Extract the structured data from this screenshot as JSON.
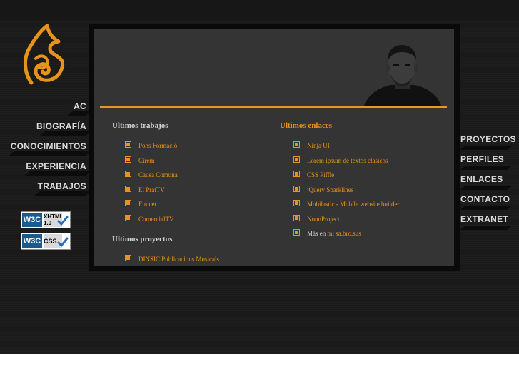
{
  "left_nav": {
    "items": [
      {
        "label": "AC"
      },
      {
        "label": "BIOGRAFÍA"
      },
      {
        "label": "CONOCIMIENTOS"
      },
      {
        "label": "EXPERIENCIA"
      },
      {
        "label": "TRABAJOS"
      }
    ]
  },
  "right_nav": {
    "items": [
      {
        "label": "PROYECTOS"
      },
      {
        "label": "PERFILES"
      },
      {
        "label": "ENLACES"
      },
      {
        "label": "CONTACTO"
      },
      {
        "label": "EXTRANET"
      }
    ]
  },
  "badges": {
    "xhtml": {
      "w3c": "W3C",
      "line1": "XHTML",
      "line2": "1.0"
    },
    "css": {
      "w3c": "W3C",
      "line1": "CSS"
    }
  },
  "content": {
    "trabajos": {
      "title": "Ultimos trabajos",
      "items": [
        "Pons Formació",
        "Cirem",
        "Causa Comuna",
        "El PratTV",
        "Euncet",
        "ComercialTV"
      ]
    },
    "proyectos": {
      "title": "Ultimos proyectos",
      "items": [
        "DINSIC Publicacions Musicals"
      ]
    },
    "enlaces": {
      "title": "Ultimos enlaces",
      "items": [
        "Ninja UI",
        "Lorem ipsum de textos clasicos",
        "CSS Piffle",
        "jQuery Sparklines",
        "Mobilastic - Mobile website builder",
        "NounProject"
      ],
      "more_prefix": "Más en",
      "more_link": "mi sa.bro.sus"
    }
  },
  "colors": {
    "background": "#1a1a1a",
    "panel": "#343434",
    "accent": "#e8941a",
    "nav_text": "#dcdcdc"
  },
  "icons": [
    "ac-logo-icon",
    "checkmark-icon",
    "bullet-square-icon"
  ]
}
